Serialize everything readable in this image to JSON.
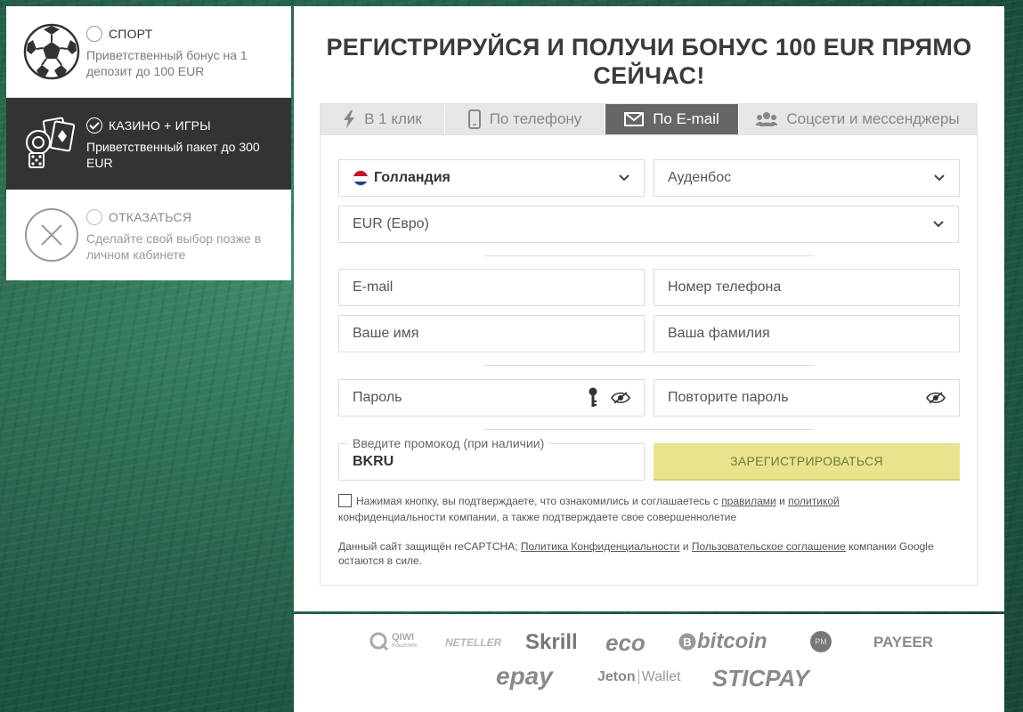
{
  "bonus_options": [
    {
      "title": "СПОРТ",
      "desc": "Приветственный бонус на 1 депозит до 100 EUR",
      "icon": "soccer-ball-icon",
      "selected": false
    },
    {
      "title": "КАЗИНО + ИГРЫ",
      "desc": "Приветственный пакет до 300 EUR",
      "icon": "casino-chips-cards-icon",
      "selected": true
    },
    {
      "title": "ОТКАЗАТЬСЯ",
      "desc": "Сделайте свой выбор позже в личном кабинете",
      "icon": "close-circle-icon",
      "selected": false
    }
  ],
  "headline": "РЕГИСТРИРУЙСЯ И ПОЛУЧИ БОНУС 100 EUR ПРЯМО СЕЙЧАС!",
  "tabs": [
    {
      "label": "В 1 клик",
      "icon": "lightning-icon",
      "active": false
    },
    {
      "label": "По телефону",
      "icon": "phone-icon",
      "active": false
    },
    {
      "label": "По E-mail",
      "icon": "envelope-icon",
      "active": true
    },
    {
      "label": "Соцсети и мессенджеры",
      "icon": "users-icon",
      "active": false
    }
  ],
  "form": {
    "country": "Голландия",
    "city": "Ауденбос",
    "currency": "EUR (Евро)",
    "email_placeholder": "E-mail",
    "phone_placeholder": "Номер телефона",
    "first_name_placeholder": "Ваше имя",
    "last_name_placeholder": "Ваша фамилия",
    "password_placeholder": "Пароль",
    "repeat_password_placeholder": "Повторите пароль",
    "promo_label": "Введите промокод (при наличии)",
    "promo_value": "BKRU",
    "register_button": "ЗАРЕГИСТРИРОВАТЬСЯ",
    "agree_text_1": "Нажимая кнопку, вы подтверждаете, что ознакомились и соглашаетесь с",
    "agree_link_rules": "правилами",
    "agree_and": "и",
    "agree_link_policy": "политикой",
    "agree_text_2": "конфиденциальности компании, а также подтверждаете свое совершеннолетие",
    "recaptcha_1": "Данный сайт защищён reCAPTCHA;",
    "recaptcha_link_privacy": "Политика Конфиденциальности",
    "recaptcha_and": "и",
    "recaptcha_link_terms": "Пользовательское соглашение",
    "recaptcha_2": "компании Google остаются в силе."
  },
  "payments": {
    "qiwi": "QIWI",
    "qiwi_sub": "Кошелек",
    "neteller": "NETELLER",
    "skrill": "Skrill",
    "eco": "eco",
    "bitcoin": "bitcoin",
    "pm": "PM",
    "payeer": "PAYEER",
    "epay": "epay",
    "jeton": "Jeton",
    "jeton_wallet": "Wallet",
    "sticpay": "STICPAY"
  },
  "colors": {
    "accent_button": "#eae38e",
    "active_panel": "#333333",
    "active_tab": "#666666",
    "background": "#2d6e53"
  }
}
